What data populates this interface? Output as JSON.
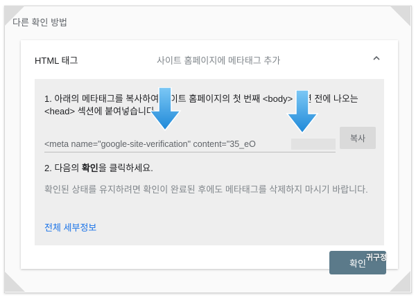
{
  "section_title": "다른 확인 방법",
  "method": {
    "label": "HTML 태그",
    "description": "사이트 홈페이지에 메타태그 추가"
  },
  "step1": {
    "text": "1. 아래의 메타태그를 복사하여 사이트 홈페이지의 첫 번째 <body> 섹션 전에 나오는 <head> 섹션에 붙여넣습니다."
  },
  "code_field": {
    "value": "<meta name=\"google-site-verification\" content=\"35_eO"
  },
  "copy_button": {
    "label": "복사"
  },
  "step2": {
    "prefix": "2. 다음의 ",
    "bold": "확인",
    "suffix": "을 클릭하세요."
  },
  "note": "확인된 상태를 유지하려면 확인이 완료된 후에도 메타태그를 삭제하지 마시기 바랍니다.",
  "details_link": "전체 세부정보",
  "confirm_button": {
    "label": "확인"
  },
  "watermark": "귀구정",
  "colors": {
    "link": "#1a73e8",
    "confirm_button": "#5b7a8a",
    "arrow": "#2f9be0"
  },
  "icons": [
    "chevron-up-icon",
    "down-arrow-icon"
  ]
}
